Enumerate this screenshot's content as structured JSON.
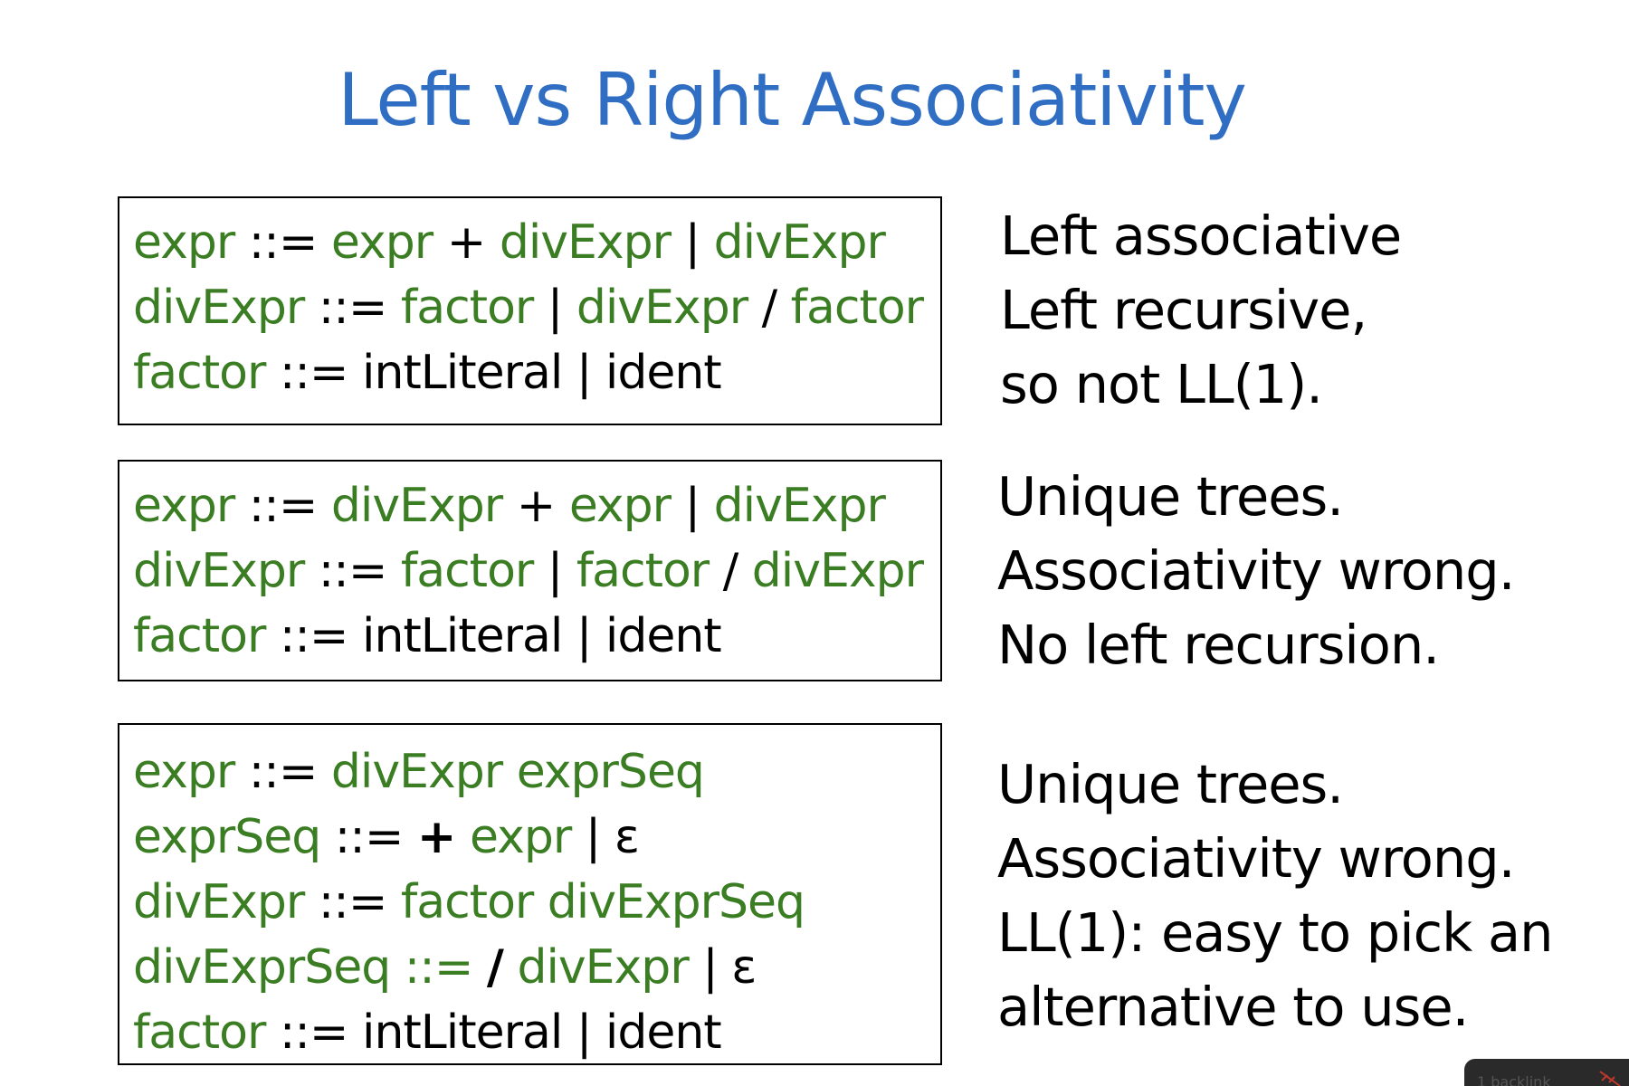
{
  "title": "Left vs Right Associativity",
  "grammars": [
    {
      "rules": [
        [
          [
            "nt",
            "expr"
          ],
          [
            "tk",
            " ::= "
          ],
          [
            "nt",
            "expr"
          ],
          [
            "tk",
            " + "
          ],
          [
            "nt",
            "divExpr"
          ],
          [
            "tk",
            " | "
          ],
          [
            "nt",
            "divExpr"
          ]
        ],
        [
          [
            "nt",
            "divExpr"
          ],
          [
            "tk",
            " ::= "
          ],
          [
            "nt",
            "factor"
          ],
          [
            "tk",
            " | "
          ],
          [
            "nt",
            "divExpr"
          ],
          [
            "tk",
            " / "
          ],
          [
            "nt",
            "factor"
          ]
        ],
        [
          [
            "nt",
            "factor"
          ],
          [
            "tk",
            " ::= "
          ],
          [
            "tk",
            "intLiteral | ident"
          ]
        ]
      ]
    },
    {
      "rules": [
        [
          [
            "nt",
            "expr"
          ],
          [
            "tk",
            " ::= "
          ],
          [
            "nt",
            "divExpr"
          ],
          [
            "tk",
            " + "
          ],
          [
            "nt",
            "expr"
          ],
          [
            "tk",
            " | "
          ],
          [
            "nt",
            "divExpr"
          ]
        ],
        [
          [
            "nt",
            "divExpr"
          ],
          [
            "tk",
            " ::= "
          ],
          [
            "nt",
            "factor"
          ],
          [
            "tk",
            " | "
          ],
          [
            "nt",
            "factor"
          ],
          [
            "tk",
            " / "
          ],
          [
            "nt",
            "divExpr"
          ]
        ],
        [
          [
            "nt",
            "factor"
          ],
          [
            "tk",
            " ::= "
          ],
          [
            "tk",
            "intLiteral | ident"
          ]
        ]
      ]
    },
    {
      "rules": [
        [
          [
            "nt",
            "expr"
          ],
          [
            "tk",
            " ::= "
          ],
          [
            "nt",
            "divExpr exprSeq"
          ]
        ],
        [
          [
            "nt",
            "exprSeq"
          ],
          [
            "tk",
            " ::= "
          ],
          [
            "bd",
            "+"
          ],
          [
            "tk",
            " "
          ],
          [
            "nt",
            "expr"
          ],
          [
            "tk",
            " | ε"
          ]
        ],
        [
          [
            "nt",
            "divExpr"
          ],
          [
            "tk",
            " ::= "
          ],
          [
            "nt",
            "factor divExprSeq"
          ]
        ],
        [
          [
            "nt",
            "divExprSeq ::= "
          ],
          [
            "bd",
            "/"
          ],
          [
            "tk",
            " "
          ],
          [
            "nt",
            "divExpr"
          ],
          [
            "tk",
            " | ε"
          ]
        ],
        [
          [
            "nt",
            "factor"
          ],
          [
            "tk",
            " ::= "
          ],
          [
            "tk",
            "intLiteral | ident"
          ]
        ]
      ]
    }
  ],
  "notes": [
    [
      "Left associative",
      "Left recursive,",
      "so not LL(1)."
    ],
    [
      "Unique trees.",
      "Associativity wrong.",
      "No left recursion."
    ],
    [
      "Unique trees.",
      "Associativity wrong.",
      "LL(1): easy to pick an",
      "alternative to use."
    ]
  ],
  "backlinks": {
    "label": "1 backlink",
    "icon": "unlink-icon"
  },
  "colors": {
    "title": "#2f6ec3",
    "nonterminal": "#3a7d22",
    "text": "#000000"
  }
}
